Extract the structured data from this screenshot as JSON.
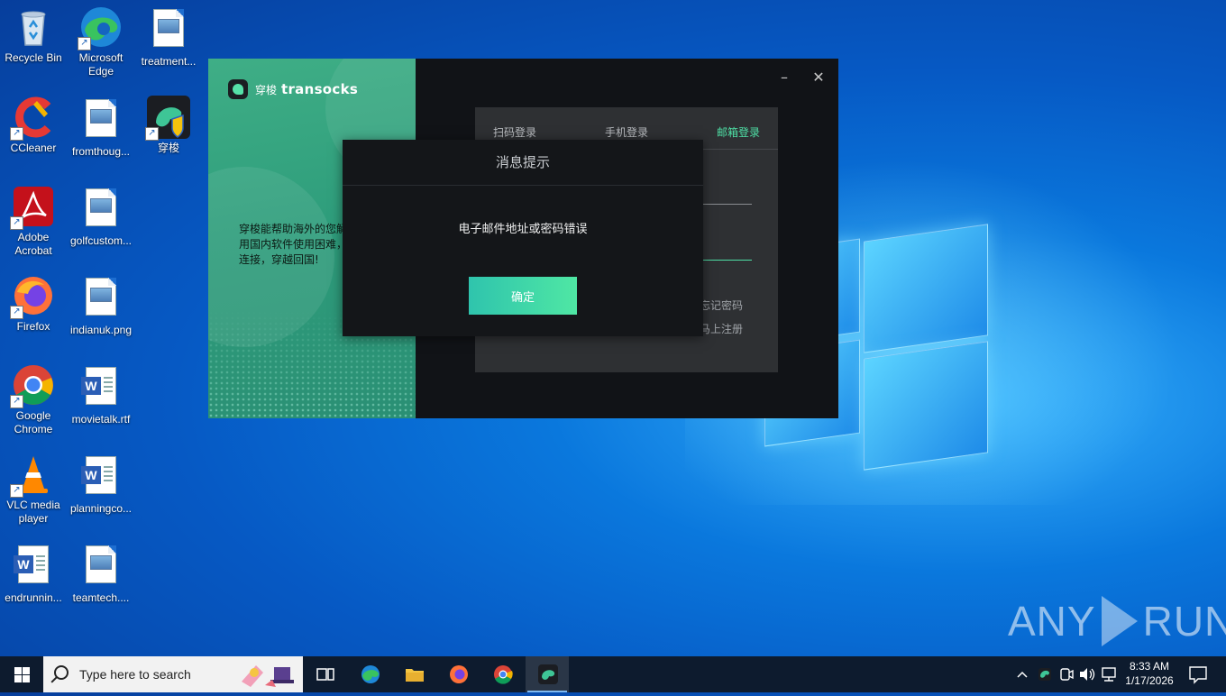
{
  "desktop": {
    "icons": [
      {
        "label": "Recycle Bin"
      },
      {
        "label": "Microsoft Edge"
      },
      {
        "label": "treatment..."
      },
      {
        "label": "CCleaner"
      },
      {
        "label": "fromthoug..."
      },
      {
        "label": "穿梭"
      },
      {
        "label": "Adobe Acrobat"
      },
      {
        "label": "golfcustom..."
      },
      {
        "label": "Firefox"
      },
      {
        "label": "indianuk.png"
      },
      {
        "label": "Google Chrome"
      },
      {
        "label": "movietalk.rtf"
      },
      {
        "label": "VLC media player"
      },
      {
        "label": "planningco..."
      },
      {
        "label": "endrunnin..."
      },
      {
        "label": "teamtech...."
      }
    ]
  },
  "app": {
    "brand_cn": "穿梭",
    "brand_en": "transocks",
    "tagline": "穿梭能帮助海外的您解决使用国内软件使用困难，一键连接，穿越回国!",
    "minimize_icon": "–",
    "close_icon": "✕",
    "tabs": [
      {
        "label": "扫码登录"
      },
      {
        "label": "手机登录"
      },
      {
        "label": "邮箱登录"
      }
    ],
    "forgot_password": "忘记密码",
    "register": "马上注册"
  },
  "modal": {
    "title": "消息提示",
    "message": "电子邮件地址或密码错误",
    "ok_label": "确定"
  },
  "watermark": {
    "left": "ANY",
    "right": "RUN"
  },
  "taskbar": {
    "search_placeholder": "Type here to search",
    "clock_time": "8:33 AM",
    "clock_date": "1/17/2026"
  },
  "colors": {
    "accent_green": "#4fe0a6",
    "app_bg": "#111317",
    "taskbar_bg": "#0d1b2e"
  }
}
